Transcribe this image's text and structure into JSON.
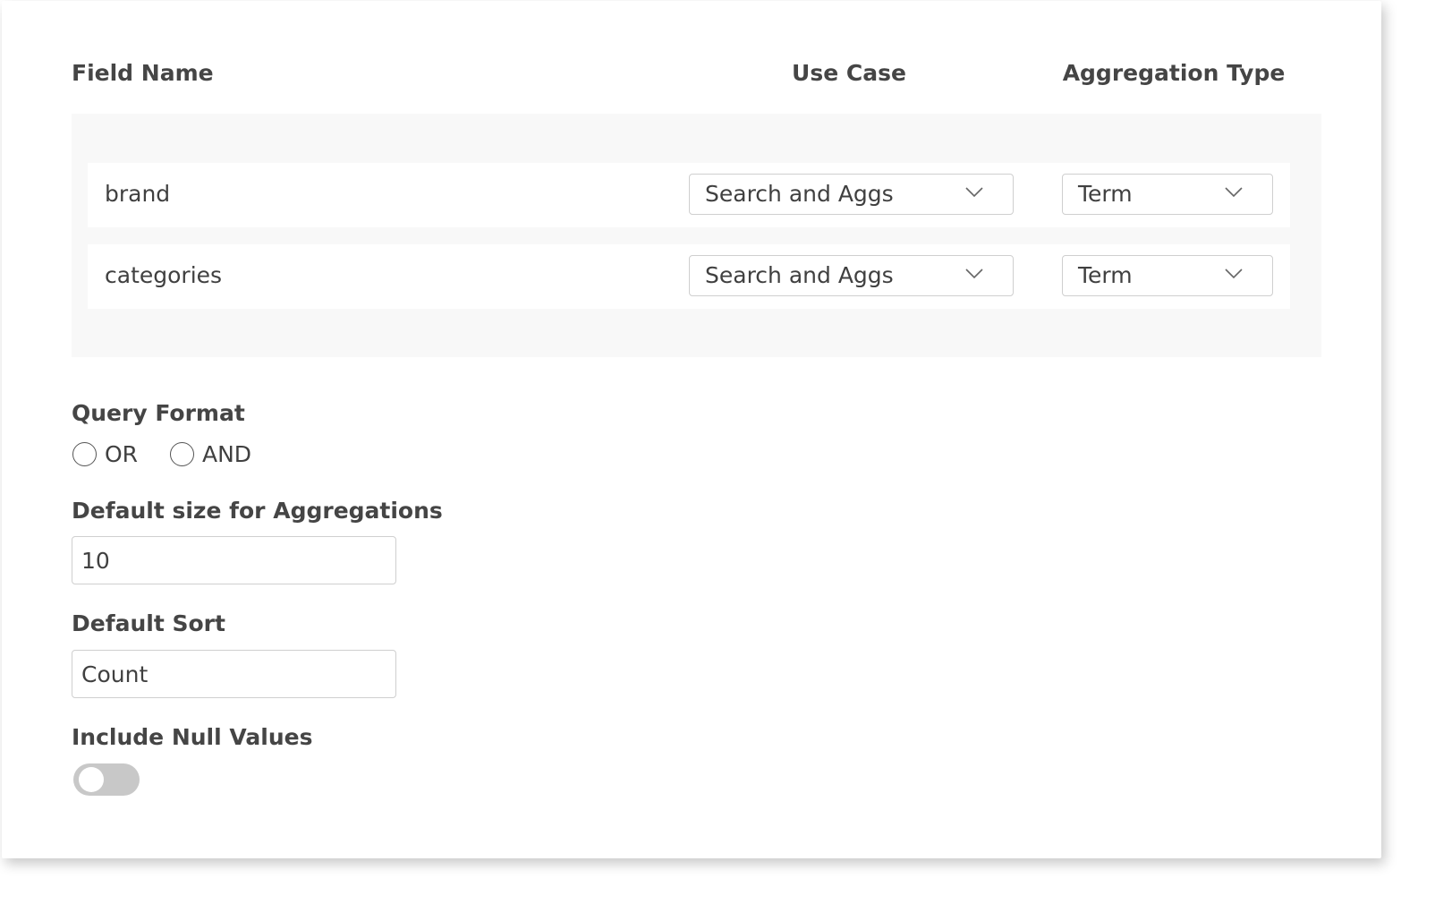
{
  "table": {
    "headers": {
      "field_name": "Field Name",
      "use_case": "Use Case",
      "aggregation_type": "Aggregation Type"
    },
    "rows": [
      {
        "field": "brand",
        "use_case": "Search and Aggs",
        "aggregation_type": "Term"
      },
      {
        "field": "categories",
        "use_case": "Search and Aggs",
        "aggregation_type": "Term"
      }
    ]
  },
  "query_format": {
    "label": "Query Format",
    "options": [
      "OR",
      "AND"
    ],
    "selected": null
  },
  "default_size": {
    "label": "Default size for Aggregations",
    "value": "10"
  },
  "default_sort": {
    "label": "Default Sort",
    "value": "Count"
  },
  "include_null": {
    "label": "Include Null Values",
    "enabled": false
  },
  "icons": {
    "select_arrow": "chevron-down-icon"
  },
  "colors": {
    "text": "#404040",
    "table_bg": "#f8f8f8",
    "border": "#cfcfcf",
    "toggle_off": "#c8c8c8"
  }
}
